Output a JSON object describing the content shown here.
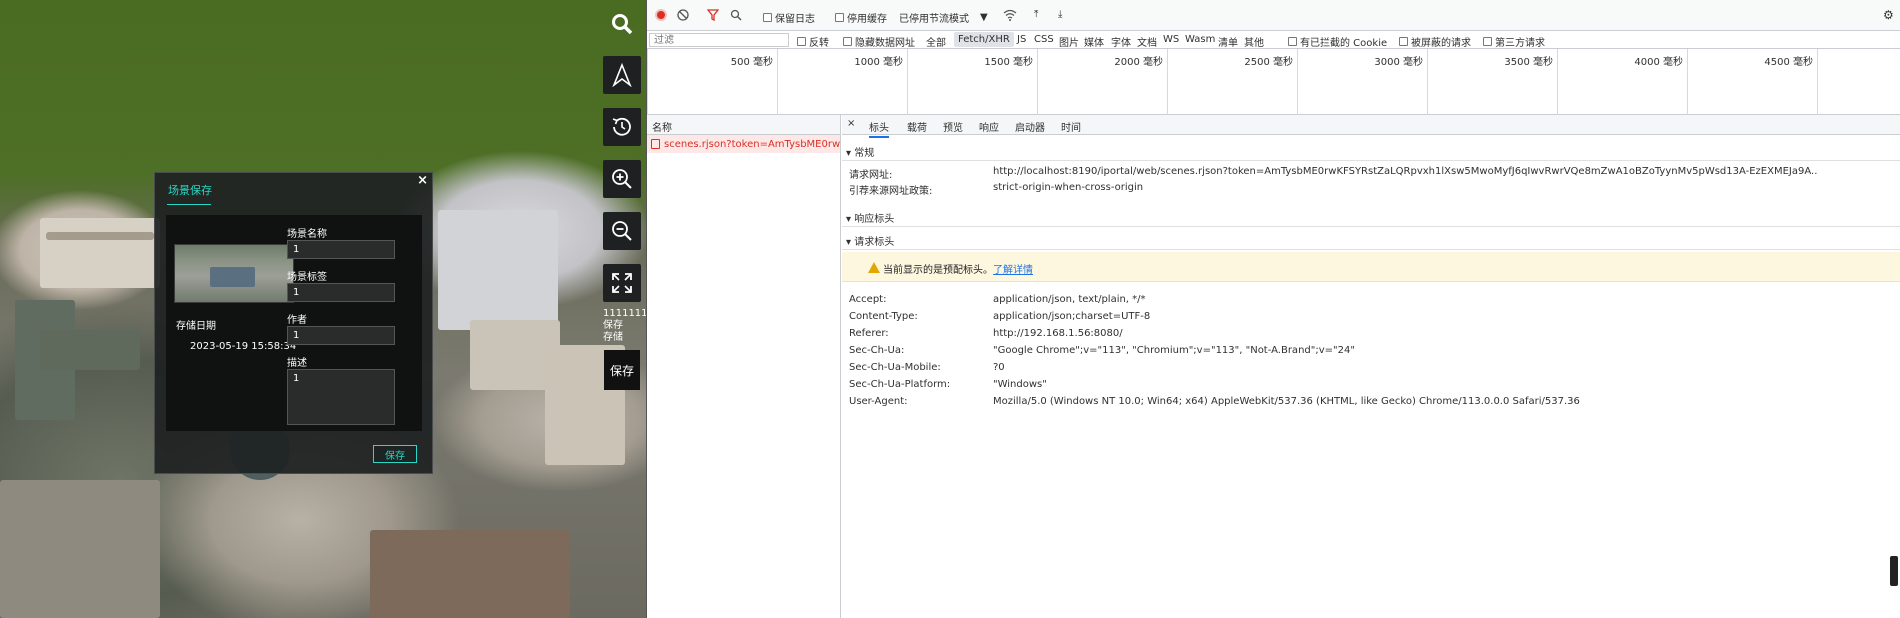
{
  "viewer": {
    "dialog": {
      "title": "场景保存",
      "close": "×",
      "name_label": "场景名称",
      "name_value": "1",
      "tag_label": "场景标签",
      "tag_value": "1",
      "author_label": "作者",
      "author_value": "1",
      "desc_label": "描述",
      "desc_value": "1",
      "date_label": "存储日期",
      "date_value": "2023-05-19 15:58:34",
      "save_label": "保存"
    },
    "side_text": [
      "11111111",
      "保存",
      "存储"
    ],
    "side_save": "保存",
    "toolbar": [
      "search-icon",
      "compass-icon",
      "history-icon",
      "zoom-in-icon",
      "zoom-out-icon",
      "fullscreen-icon"
    ]
  },
  "devtools": {
    "toolbar": {
      "preserve_log": "保留日志",
      "disable_cache": "停用缓存",
      "throttle": "已停用节流模式"
    },
    "filter": {
      "placeholder": "过滤",
      "invert": "反转",
      "hide_data_urls": "隐藏数据网址",
      "types": [
        "全部",
        "Fetch/XHR",
        "JS",
        "CSS",
        "图片",
        "媒体",
        "字体",
        "文档",
        "WS",
        "Wasm",
        "清单",
        "其他"
      ],
      "selected": "Fetch/XHR",
      "blocked_cookies": "有已拦截的 Cookie",
      "blocked_requests": "被屏蔽的请求",
      "third_party": "第三方请求"
    },
    "timeline": [
      "500 毫秒",
      "1000 毫秒",
      "1500 毫秒",
      "2000 毫秒",
      "2500 毫秒",
      "3000 毫秒",
      "3500 毫秒",
      "4000 毫秒",
      "4500 毫秒"
    ],
    "name_header": "名称",
    "request_name": "scenes.rjson?token=AmTysbME0rw...",
    "tabs": {
      "close": "×",
      "headers": "标头",
      "payload": "载荷",
      "preview": "预览",
      "response": "响应",
      "initiator": "启动器",
      "timing": "时间"
    },
    "general": {
      "title": "常规",
      "url_key": "请求网址:",
      "url_value": "http://localhost:8190/iportal/web/scenes.rjson?token=AmTysbME0rwKFSYRstZaLQRpvxh1lXsw5MwoMyfJ6qIwvRwrVQe8mZwA1oBZoTyynMv5pWsd13A-EzEXMEJa9A..",
      "policy_key": "引荐来源网址政策:",
      "policy_value": "strict-origin-when-cross-origin"
    },
    "response_headers": "响应标头",
    "request_headers": {
      "title": "请求标头",
      "warning": "当前显示的是预配标头。",
      "learn_more": "了解详情",
      "rows": [
        {
          "k": "Accept:",
          "v": "application/json, text/plain, */*"
        },
        {
          "k": "Content-Type:",
          "v": "application/json;charset=UTF-8"
        },
        {
          "k": "Referer:",
          "v": "http://192.168.1.56:8080/"
        },
        {
          "k": "Sec-Ch-Ua:",
          "v": "\"Google Chrome\";v=\"113\", \"Chromium\";v=\"113\", \"Not-A.Brand\";v=\"24\""
        },
        {
          "k": "Sec-Ch-Ua-Mobile:",
          "v": "?0"
        },
        {
          "k": "Sec-Ch-Ua-Platform:",
          "v": "\"Windows\""
        },
        {
          "k": "User-Agent:",
          "v": "Mozilla/5.0 (Windows NT 10.0; Win64; x64) AppleWebKit/537.36 (KHTML, like Gecko) Chrome/113.0.0.0 Safari/537.36"
        }
      ]
    }
  }
}
